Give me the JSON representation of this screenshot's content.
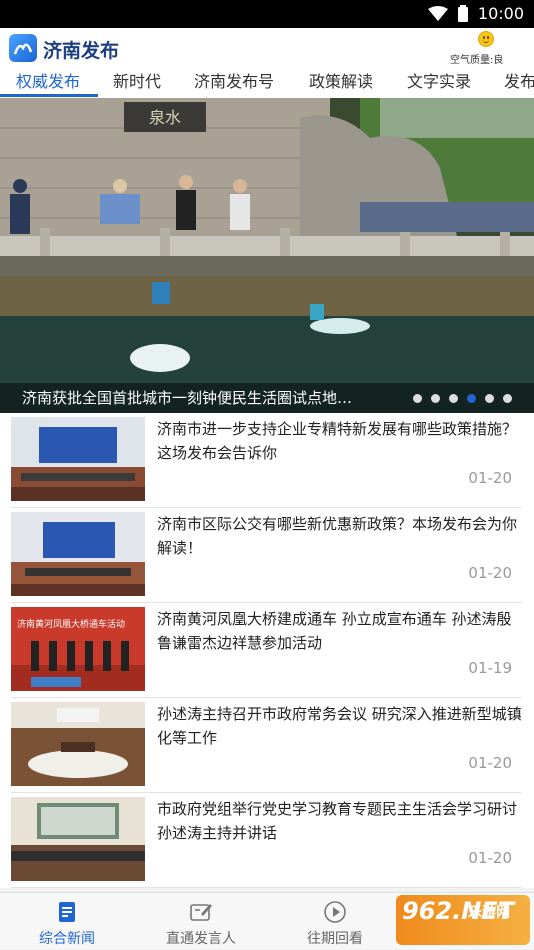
{
  "status_bar": {
    "time": "10:00"
  },
  "app": {
    "title": "济南发布",
    "air_quality": "空气质量:良"
  },
  "tabs": [
    {
      "label": "权威发布",
      "active": true
    },
    {
      "label": "新时代"
    },
    {
      "label": "济南发布号"
    },
    {
      "label": "政策解读"
    },
    {
      "label": "文字实录"
    },
    {
      "label": "发布"
    }
  ],
  "hero": {
    "caption": "济南获批全国首批城市一刻钟便民生活圈试点地…",
    "dot_count": 6,
    "active_dot_index": 3,
    "sign_text": "泉水"
  },
  "news": [
    {
      "title": "济南市进一步支持企业专精特新发展有哪些政策措施？这场发布会告诉你",
      "date": "01-20"
    },
    {
      "title": "济南市区际公交有哪些新优惠新政策？本场发布会为你解读！",
      "date": "01-20"
    },
    {
      "title": "济南黄河凤凰大桥建成通车  孙立成宣布通车  孙述涛殷鲁谦雷杰边祥慧参加活动",
      "date": "01-19",
      "thumb_banner": "济南黄河凤凰大桥通车活动"
    },
    {
      "title": "孙述涛主持召开市政府常务会议  研究深入推进新型城镇化等工作",
      "date": "01-20"
    },
    {
      "title": "市政府党组举行党史学习教育专题民主生活会学习研讨  孙述涛主持并讲话",
      "date": "01-20"
    }
  ],
  "bottom_nav": [
    {
      "label": "综合新闻",
      "icon": "news-icon",
      "active": true
    },
    {
      "label": "直通发言人",
      "icon": "edit-icon"
    },
    {
      "label": "往期回看",
      "icon": "play-icon"
    }
  ],
  "watermark": {
    "logo": "962.NET",
    "text1": "乐游网",
    "text2": ""
  },
  "colors": {
    "accent": "#1f66d3",
    "title_blue": "#1d3f82"
  }
}
